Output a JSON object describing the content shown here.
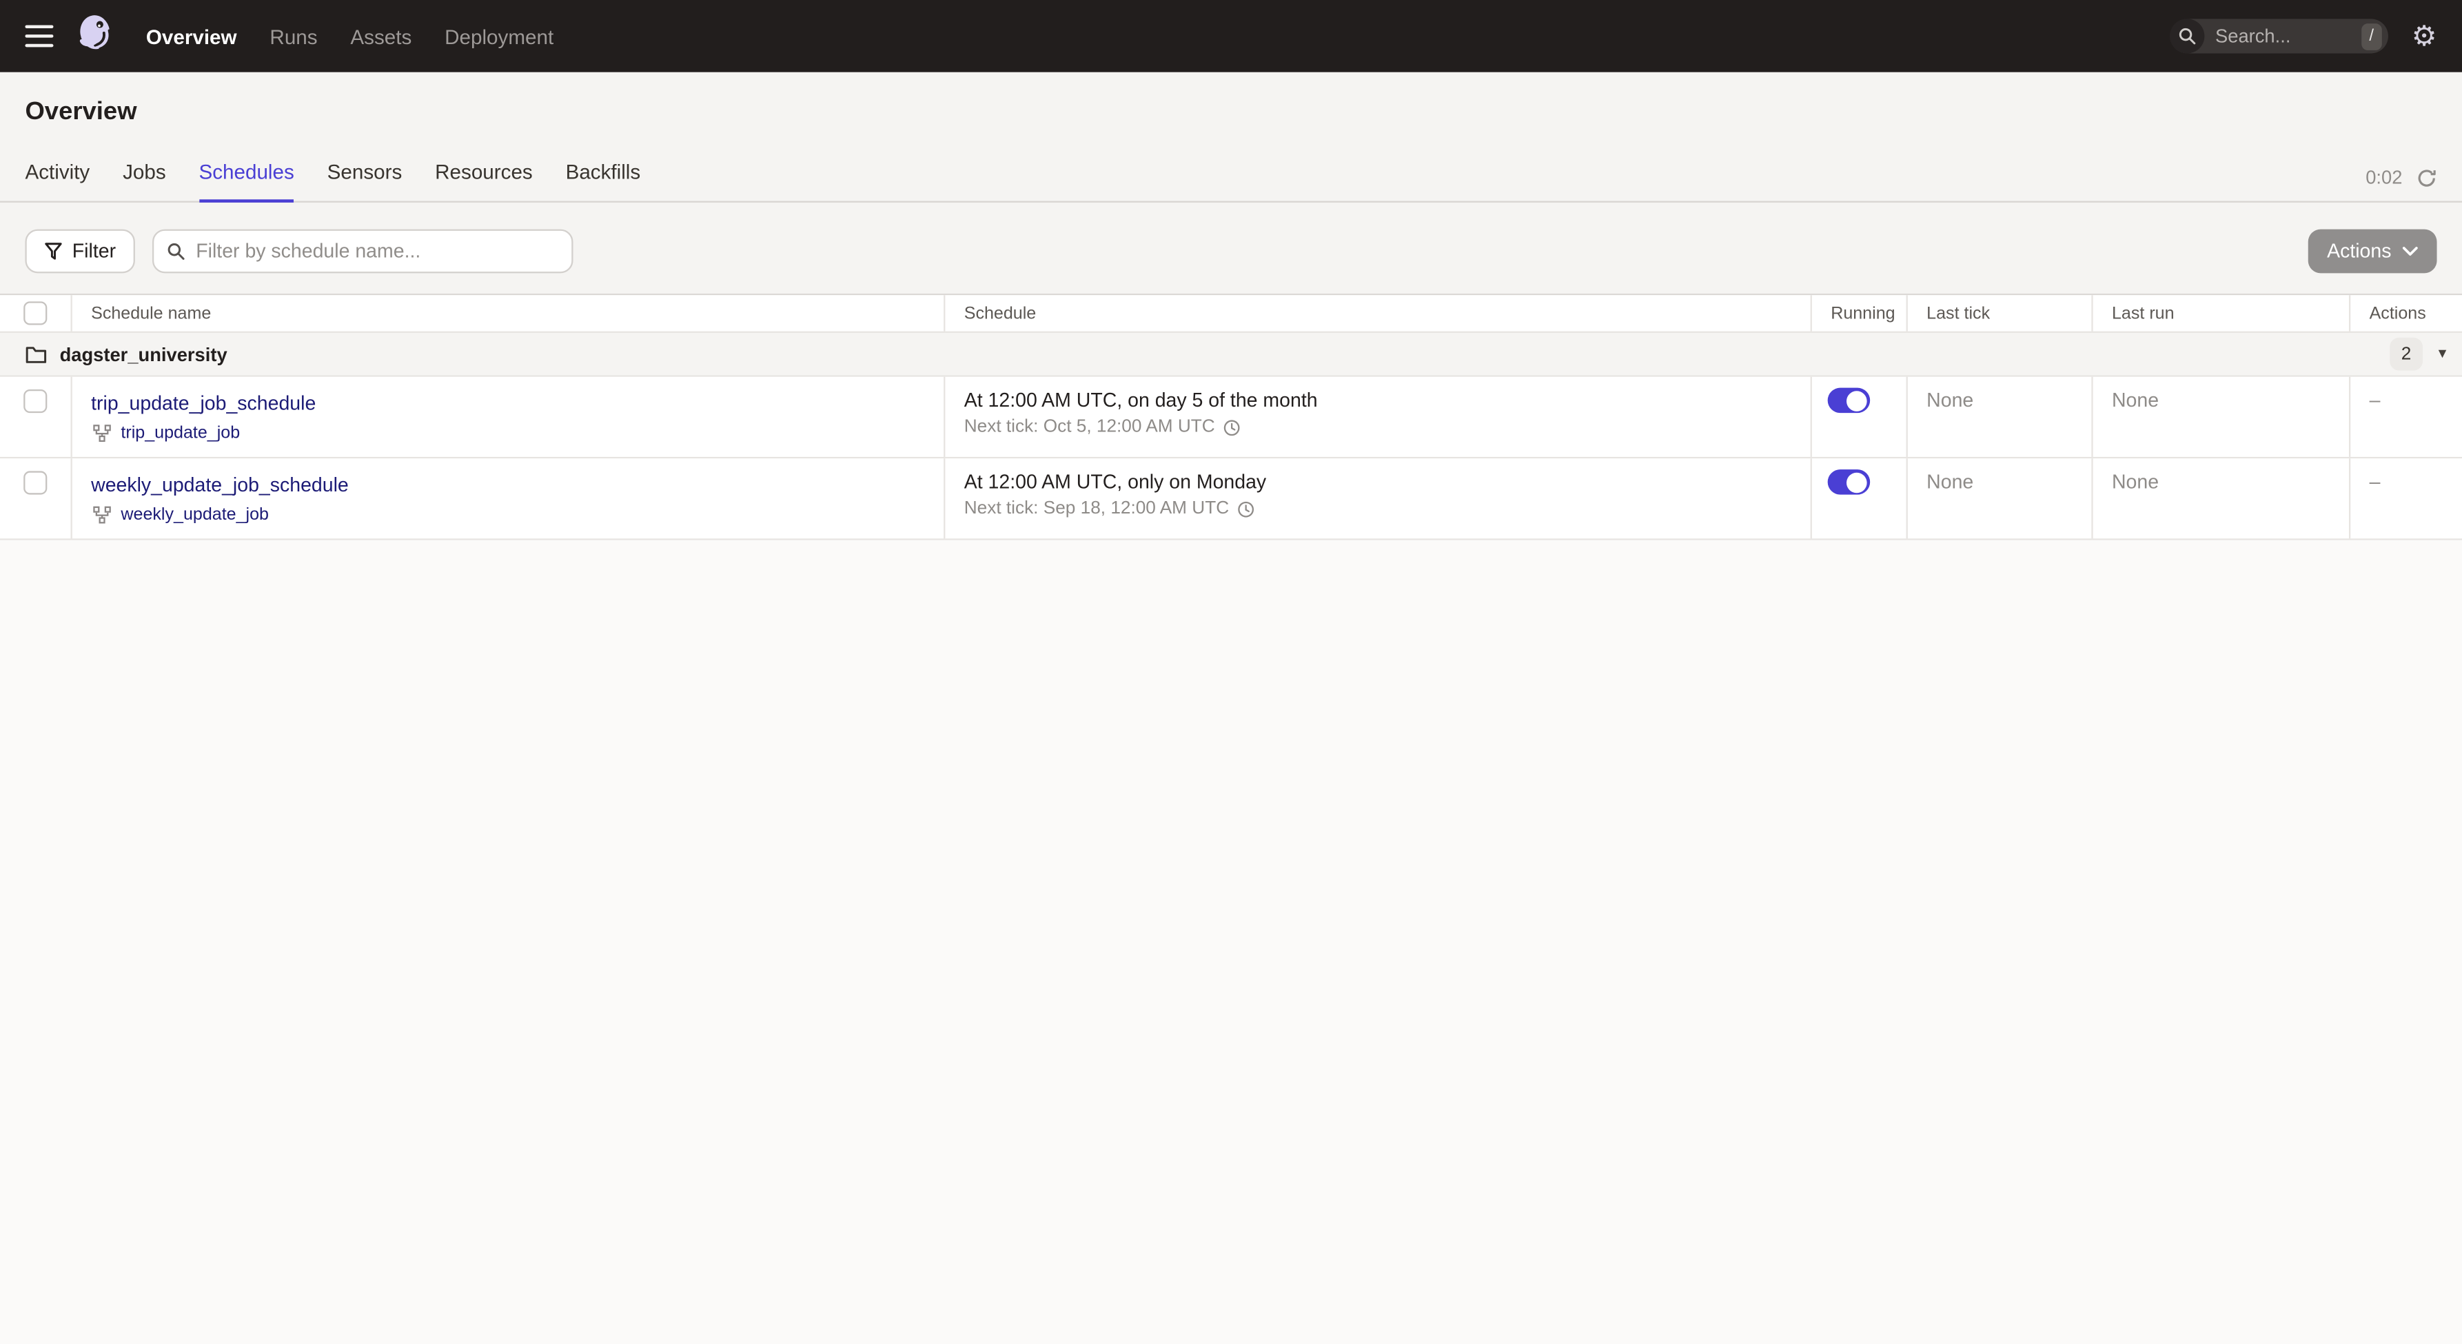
{
  "nav": {
    "links": [
      {
        "label": "Overview",
        "active": true
      },
      {
        "label": "Runs",
        "active": false
      },
      {
        "label": "Assets",
        "active": false
      },
      {
        "label": "Deployment",
        "active": false
      }
    ],
    "search": {
      "placeholder": "Search...",
      "shortcut": "/"
    }
  },
  "page": {
    "title": "Overview"
  },
  "tabs": {
    "items": [
      {
        "label": "Activity",
        "active": false
      },
      {
        "label": "Jobs",
        "active": false
      },
      {
        "label": "Schedules",
        "active": true
      },
      {
        "label": "Sensors",
        "active": false
      },
      {
        "label": "Resources",
        "active": false
      },
      {
        "label": "Backfills",
        "active": false
      }
    ],
    "timer": "0:02"
  },
  "toolbar": {
    "filter_label": "Filter",
    "filter_placeholder": "Filter by schedule name...",
    "actions_label": "Actions"
  },
  "table": {
    "columns": [
      "Schedule name",
      "Schedule",
      "Running",
      "Last tick",
      "Last run",
      "Actions"
    ],
    "group": {
      "name": "dagster_university",
      "count": "2"
    },
    "rows": [
      {
        "name": "trip_update_job_schedule",
        "job": "trip_update_job",
        "schedule": "At 12:00 AM UTC, on day 5 of the month",
        "next_tick": "Next tick: Oct 5, 12:00 AM UTC",
        "running": true,
        "last_tick": "None",
        "last_run": "None",
        "actions_value": "–"
      },
      {
        "name": "weekly_update_job_schedule",
        "job": "weekly_update_job",
        "schedule": "At 12:00 AM UTC, only on Monday",
        "next_tick": "Next tick: Sep 18, 12:00 AM UTC",
        "running": true,
        "last_tick": "None",
        "last_run": "None",
        "actions_value": "–"
      }
    ]
  },
  "colors": {
    "accent": "#4a3fd4",
    "link": "#1c1b76",
    "nav_bg": "#221e1d",
    "page_bg": "#f5f4f2"
  }
}
